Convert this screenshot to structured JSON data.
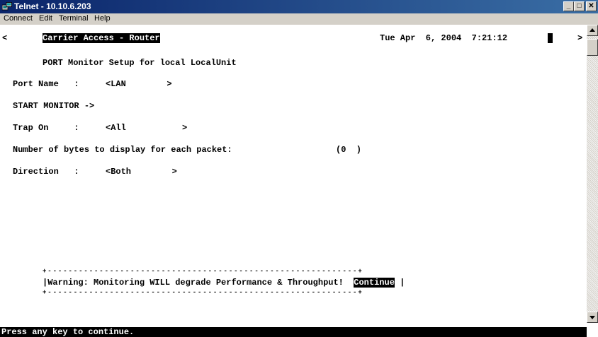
{
  "window": {
    "title": "Telnet - 10.10.6.203",
    "minimize_glyph": "_",
    "maximize_glyph": "□",
    "close_glyph": "✕"
  },
  "menu": {
    "connect": "Connect",
    "edit": "Edit",
    "terminal": "Terminal",
    "help": "Help"
  },
  "terminal": {
    "left_marker": "<",
    "header_title": "Carrier Access - Router",
    "datetime": "Tue Apr  6, 2004  7:21:12",
    "right_marker": ">",
    "screen_title": "PORT Monitor Setup for local LocalUnit",
    "port_name_label": "Port Name   : ",
    "port_name_value": "<LAN        >",
    "start_monitor": "START MONITOR ->",
    "trap_on_label": "Trap On     : ",
    "trap_on_value": "<All           >",
    "bytes_label": "Number of bytes to display for each packet:",
    "bytes_value": "(0  )",
    "direction_label": "Direction   : ",
    "direction_value": "<Both        >",
    "box_border": "+------------------------------------------------------------+",
    "warning_text": "|Warning: Monitoring WILL degrade Performance & Throughput!  ",
    "continue_label": "Continue",
    "box_right": " |",
    "status_text": "Press any key to continue."
  },
  "colors": {
    "titlebar_start": "#0a246a",
    "titlebar_end": "#3a6ea5",
    "menubar": "#d4d0c8",
    "terminal_bg": "#ffffff",
    "terminal_fg": "#000000"
  }
}
